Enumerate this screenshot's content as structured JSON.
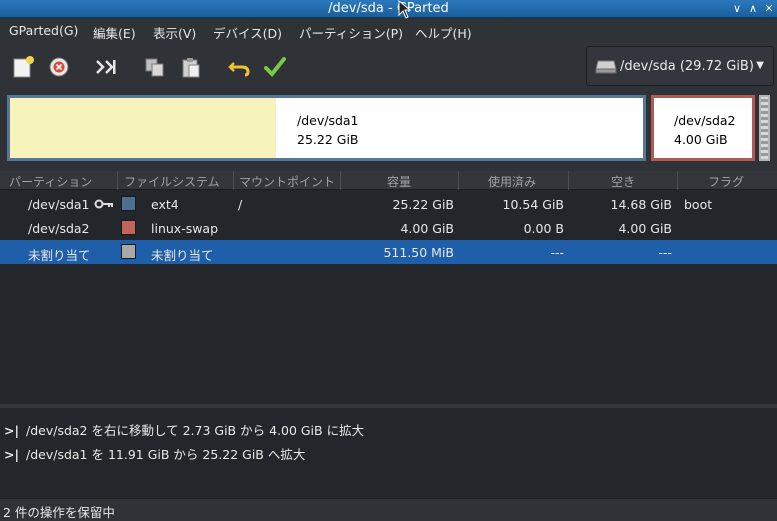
{
  "window": {
    "title": "/dev/sda - GParted"
  },
  "menu": [
    "GParted(G)",
    "編集(E)",
    "表示(V)",
    "デバイス(D)",
    "パーティション(P)",
    "ヘルプ(H)"
  ],
  "toolbar": {
    "buttons": [
      "new-icon",
      "delete-icon",
      "resize-move-icon",
      "copy-icon",
      "paste-icon",
      "undo-icon",
      "apply-icon"
    ],
    "device_selector": "/dev/sda   (29.72 GiB)"
  },
  "visual": {
    "partitions": [
      {
        "name": "/dev/sda1",
        "size": "25.22 GiB",
        "fs_color": "#577796",
        "used_fraction": 0.42
      },
      {
        "name": "/dev/sda2",
        "size": "4.00 GiB",
        "fs_color": "#b05c55"
      }
    ]
  },
  "table": {
    "headers": [
      "パーティション",
      "ファイルシステム",
      "マウントポイント",
      "容量",
      "使用済み",
      "空き",
      "フラグ"
    ],
    "rows": [
      {
        "partition": "/dev/sda1",
        "locked": true,
        "fs": "ext4",
        "fs_color": "#4d6f92",
        "mount": "/",
        "size": "25.22 GiB",
        "used": "10.54 GiB",
        "free": "14.68 GiB",
        "flags": "boot",
        "selected": false
      },
      {
        "partition": "/dev/sda2",
        "locked": false,
        "fs": "linux-swap",
        "fs_color": "#c2645a",
        "mount": "",
        "size": "4.00 GiB",
        "used": "0.00 B",
        "free": "4.00 GiB",
        "flags": "",
        "selected": false
      },
      {
        "partition": "未割り当て",
        "locked": false,
        "fs": "未割り当て",
        "fs_color": "#a8a8a8",
        "mount": "",
        "size": "511.50 MiB",
        "used": "---",
        "free": "---",
        "flags": "",
        "selected": true
      }
    ]
  },
  "pending_ops": [
    "/dev/sda2 を右に移動して 2.73 GiB から 4.00 GiB に拡大",
    "/dev/sda1 を 11.91 GiB から 25.22 GiB へ拡大"
  ],
  "status": "2 件の操作を保留中"
}
